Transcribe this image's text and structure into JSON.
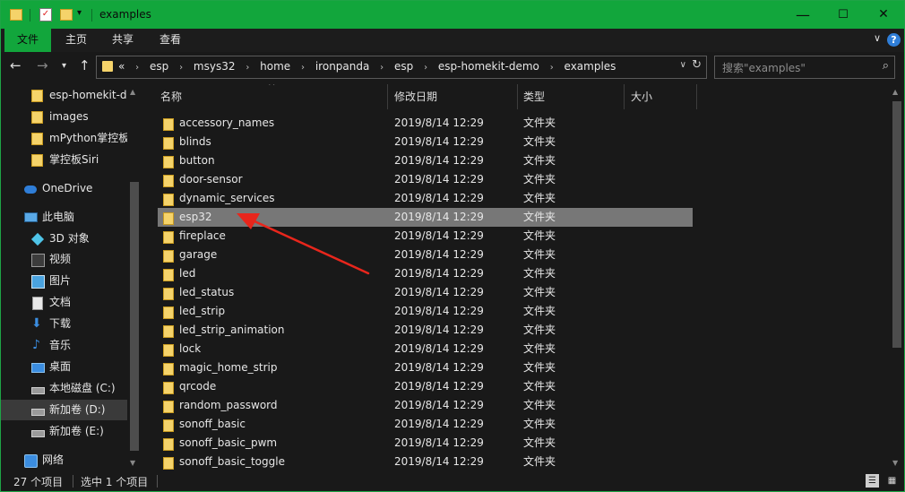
{
  "window": {
    "title": "examples",
    "min_glyph": "—",
    "max_glyph": "☐",
    "close_glyph": "✕"
  },
  "ribbon": {
    "tabs": [
      "文件",
      "主页",
      "共享",
      "查看"
    ]
  },
  "address": {
    "prefix": "«",
    "crumbs": [
      "esp",
      "msys32",
      "home",
      "ironpanda",
      "esp",
      "esp-homekit-demo",
      "examples"
    ]
  },
  "search": {
    "placeholder": "搜索\"examples\""
  },
  "sidebar": {
    "items": [
      {
        "label": "esp-homekit-d",
        "icon": "folder-icon"
      },
      {
        "label": "images",
        "icon": "folder-icon"
      },
      {
        "label": "mPython掌控板",
        "icon": "folder-icon"
      },
      {
        "label": "掌控板Siri",
        "icon": "folder-icon"
      },
      {
        "label": "OneDrive",
        "icon": "onedrive-icon"
      },
      {
        "label": "此电脑",
        "icon": "computer-icon"
      },
      {
        "label": "3D 对象",
        "icon": "3d-objects-icon"
      },
      {
        "label": "视频",
        "icon": "video-icon"
      },
      {
        "label": "图片",
        "icon": "pictures-icon"
      },
      {
        "label": "文档",
        "icon": "documents-icon"
      },
      {
        "label": "下载",
        "icon": "download-icon"
      },
      {
        "label": "音乐",
        "icon": "music-icon"
      },
      {
        "label": "桌面",
        "icon": "desktop-icon"
      },
      {
        "label": "本地磁盘 (C:)",
        "icon": "drive-icon"
      },
      {
        "label": "新加卷 (D:)",
        "icon": "drive-icon"
      },
      {
        "label": "新加卷 (E:)",
        "icon": "drive-icon"
      },
      {
        "label": "网络",
        "icon": "network-icon"
      }
    ],
    "selected_index": 14
  },
  "columns": {
    "name": "名称",
    "date": "修改日期",
    "type": "类型",
    "size": "大小"
  },
  "files": [
    {
      "name": "accessory_names",
      "date": "2019/8/14 12:29",
      "type": "文件夹"
    },
    {
      "name": "blinds",
      "date": "2019/8/14 12:29",
      "type": "文件夹"
    },
    {
      "name": "button",
      "date": "2019/8/14 12:29",
      "type": "文件夹"
    },
    {
      "name": "door-sensor",
      "date": "2019/8/14 12:29",
      "type": "文件夹"
    },
    {
      "name": "dynamic_services",
      "date": "2019/8/14 12:29",
      "type": "文件夹"
    },
    {
      "name": "esp32",
      "date": "2019/8/14 12:29",
      "type": "文件夹"
    },
    {
      "name": "fireplace",
      "date": "2019/8/14 12:29",
      "type": "文件夹"
    },
    {
      "name": "garage",
      "date": "2019/8/14 12:29",
      "type": "文件夹"
    },
    {
      "name": "led",
      "date": "2019/8/14 12:29",
      "type": "文件夹"
    },
    {
      "name": "led_status",
      "date": "2019/8/14 12:29",
      "type": "文件夹"
    },
    {
      "name": "led_strip",
      "date": "2019/8/14 12:29",
      "type": "文件夹"
    },
    {
      "name": "led_strip_animation",
      "date": "2019/8/14 12:29",
      "type": "文件夹"
    },
    {
      "name": "lock",
      "date": "2019/8/14 12:29",
      "type": "文件夹"
    },
    {
      "name": "magic_home_strip",
      "date": "2019/8/14 12:29",
      "type": "文件夹"
    },
    {
      "name": "qrcode",
      "date": "2019/8/14 12:29",
      "type": "文件夹"
    },
    {
      "name": "random_password",
      "date": "2019/8/14 12:29",
      "type": "文件夹"
    },
    {
      "name": "sonoff_basic",
      "date": "2019/8/14 12:29",
      "type": "文件夹"
    },
    {
      "name": "sonoff_basic_pwm",
      "date": "2019/8/14 12:29",
      "type": "文件夹"
    },
    {
      "name": "sonoff_basic_toggle",
      "date": "2019/8/14 12:29",
      "type": "文件夹"
    }
  ],
  "selected_file_index": 5,
  "status": {
    "count": "27 个项目",
    "selected": "选中 1 个项目"
  },
  "colors": {
    "accent": "#12a63c",
    "background": "#191919",
    "selection": "#777777",
    "annotation_arrow": "#e8261c"
  }
}
